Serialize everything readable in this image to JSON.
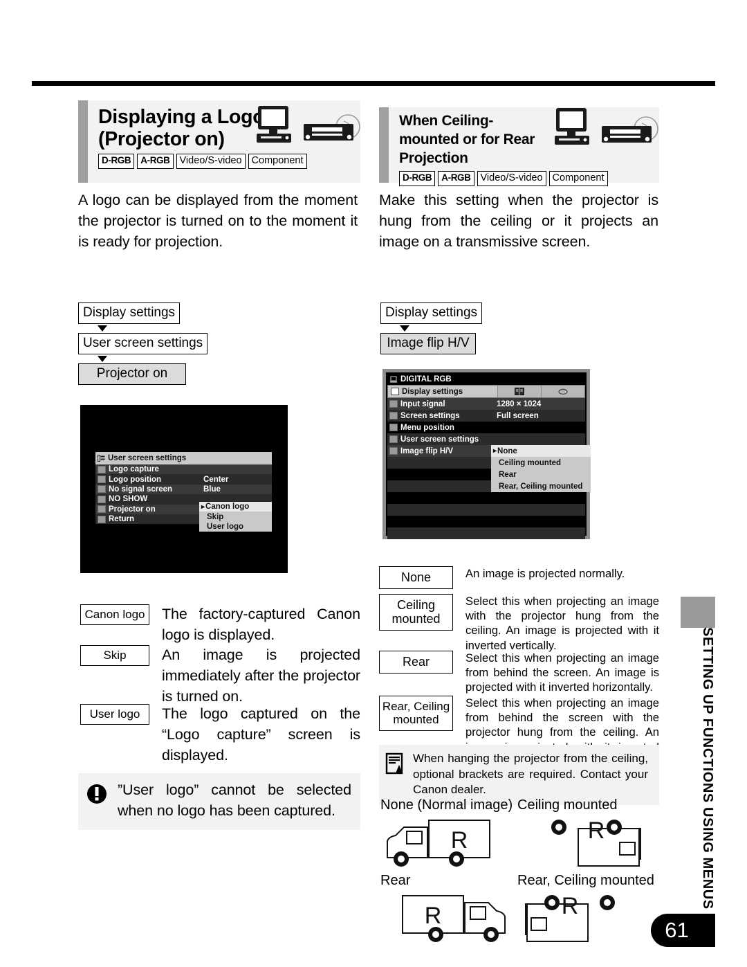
{
  "page": {
    "number": "61",
    "side_tab": "SETTING UP FUNCTIONS USING MENUS"
  },
  "left_column": {
    "title_line1": "Displaying a Logo",
    "title_line2": "(Projector on)",
    "tags": [
      "D-RGB",
      "A-RGB",
      "Video/S-video",
      "Component"
    ],
    "intro": "A logo can be displayed from the moment the projector is turned on to the moment it is ready for projection.",
    "flow": [
      {
        "label": "Display settings",
        "selected": false
      },
      {
        "label": "User screen settings",
        "selected": false
      },
      {
        "label": "Projector on",
        "selected": true
      }
    ],
    "osd": {
      "title": "User screen settings",
      "rows": [
        {
          "label": "Logo capture",
          "value": ""
        },
        {
          "label": "Logo position",
          "value": "Center"
        },
        {
          "label": "No signal screen",
          "value": "Blue"
        },
        {
          "label": "NO SHOW",
          "value": ""
        },
        {
          "label": "Projector on",
          "value": ""
        },
        {
          "label": "Return",
          "value": ""
        }
      ],
      "popup": [
        {
          "label": "Canon logo",
          "selected": true
        },
        {
          "label": "Skip",
          "selected": false
        },
        {
          "label": "User logo",
          "selected": false
        }
      ]
    },
    "definitions": [
      {
        "term": "Canon logo",
        "desc": "The factory-captured Canon logo is displayed."
      },
      {
        "term": "Skip",
        "desc": "An image is projected immediately after the projector is turned on."
      },
      {
        "term": "User logo",
        "desc": "The logo captured on the “Logo capture” screen is displayed."
      }
    ],
    "note": "”User logo” cannot be selected when no logo has been captured."
  },
  "right_column": {
    "title_line1": "When Ceiling-",
    "title_line2": "mounted or for Rear",
    "title_line3": "Projection",
    "tags": [
      "D-RGB",
      "A-RGB",
      "Video/S-video",
      "Component"
    ],
    "intro": "Make this setting when the projector is hung from the ceiling or it projects an image on a transmissive screen.",
    "flow": [
      {
        "label": "Display settings",
        "selected": false
      },
      {
        "label": "Image flip H/V",
        "selected": true
      }
    ],
    "osd": {
      "signal_title": "DIGITAL RGB",
      "menu_title": "Display settings",
      "rows": [
        {
          "label": "Input signal",
          "value": "1280 × 1024"
        },
        {
          "label": "Screen settings",
          "value": "Full screen"
        },
        {
          "label": "Menu position",
          "value": ""
        },
        {
          "label": "User screen settings",
          "value": ""
        },
        {
          "label": "Image flip H/V",
          "value": ""
        }
      ],
      "popup": [
        {
          "label": "None",
          "selected": true
        },
        {
          "label": "Ceiling mounted",
          "selected": false
        },
        {
          "label": "Rear",
          "selected": false
        },
        {
          "label": "Rear, Ceiling mounted",
          "selected": false
        }
      ]
    },
    "definitions": [
      {
        "term": "None",
        "desc": "An image is projected normally."
      },
      {
        "term": "Ceiling\nmounted",
        "desc": "Select this when projecting an image with the projector hung from the ceiling. An image is projected with it inverted vertically."
      },
      {
        "term": "Rear",
        "desc": "Select this when projecting an image from behind the screen. An image is projected with it inverted horizontally."
      },
      {
        "term": "Rear, Ceiling\nmounted",
        "desc": "Select this when projecting an image from behind the screen with the projector hung from the ceiling. An image is projected with it inverted vertically and horizontally."
      }
    ],
    "note": "When hanging the projector from the ceiling, optional brackets are required. Contact your Canon dealer.",
    "figures": [
      {
        "caption": "None (Normal image)",
        "letter": "R"
      },
      {
        "caption": "Ceiling mounted",
        "letter": "R"
      },
      {
        "caption": "Rear",
        "letter": "R"
      },
      {
        "caption": "Rear, Ceiling mounted",
        "letter": "R"
      }
    ]
  }
}
